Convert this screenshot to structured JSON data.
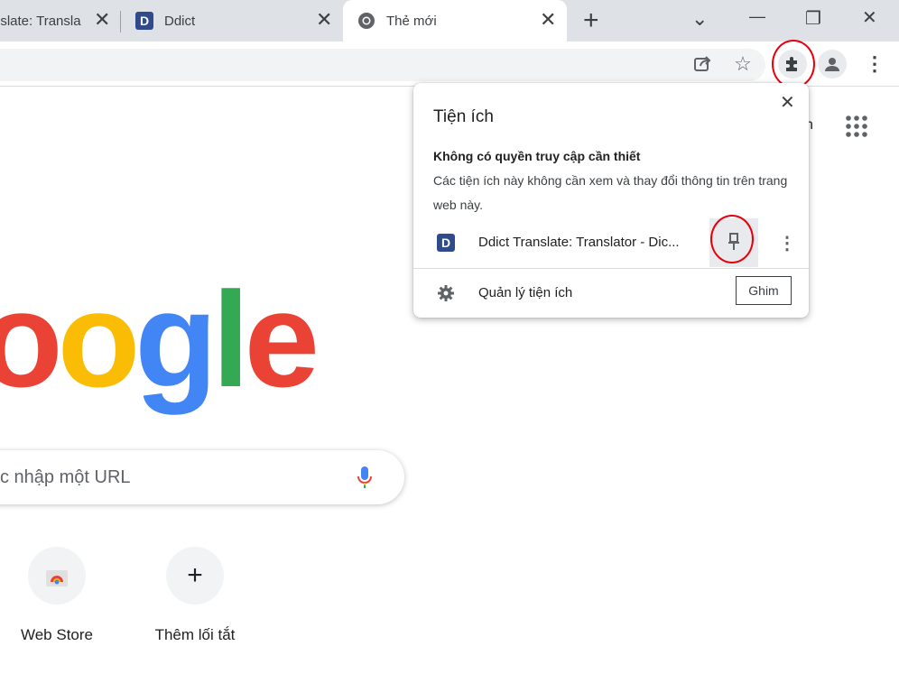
{
  "tabs": [
    {
      "title": "nslate: Transla",
      "close": "✕"
    },
    {
      "title": "Ddict",
      "favicon_letter": "D",
      "close": "✕"
    },
    {
      "title": "Thẻ mới",
      "close": "✕"
    }
  ],
  "new_tab_label": "+",
  "window_controls": {
    "list": "⌄",
    "minimize": "—",
    "restore": "❐",
    "close": "✕"
  },
  "extensions_popup": {
    "title": "Tiện ích",
    "close": "✕",
    "section_heading": "Không có quyền truy cập cần thiết",
    "section_desc": "Các tiện ích này không cần xem và thay đổi thông tin trên trang web này.",
    "extension": {
      "favicon_letter": "D",
      "name": "Ddict Translate: Translator - Dic...",
      "more": "⋮"
    },
    "manage_label": "Quản lý tiện ích",
    "pin_tooltip": "Ghim"
  },
  "google_page": {
    "logo_letters": [
      {
        "ch": "o",
        "color": "#ea4335"
      },
      {
        "ch": "o",
        "color": "#fbbc05"
      },
      {
        "ch": "g",
        "color": "#4285f4"
      },
      {
        "ch": "l",
        "color": "#34a853"
      },
      {
        "ch": "e",
        "color": "#ea4335"
      }
    ],
    "search_placeholder": "c nhập một URL",
    "partial_link": "n",
    "shortcuts": [
      {
        "label": "Web Store"
      },
      {
        "label": "Thêm lối tắt",
        "icon_text": "+"
      }
    ]
  },
  "colors": {
    "annotation": "#e8000b",
    "tabstrip": "#dee1e6"
  }
}
